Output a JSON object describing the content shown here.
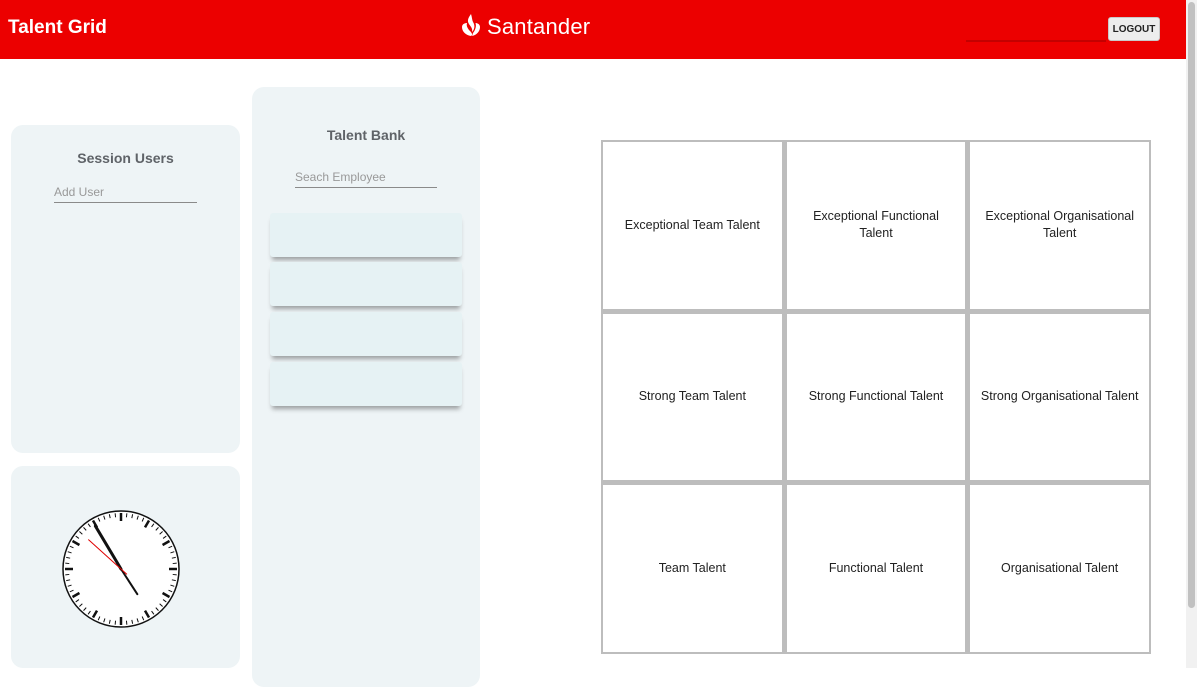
{
  "header": {
    "app_title": "Talent Grid",
    "brand_name": "Santander",
    "logout_label": "LOGOUT",
    "brand_color": "#ec0000"
  },
  "session_users": {
    "title": "Session Users",
    "add_user_placeholder": "Add User"
  },
  "talent_bank": {
    "title": "Talent Bank",
    "search_placeholder": "Seach Employee",
    "cards": [
      "",
      "",
      "",
      ""
    ]
  },
  "clock": {
    "hour": 4,
    "minute": 54,
    "second": 52
  },
  "grid": {
    "cells": [
      "Exceptional Team Talent",
      "Exceptional Functional Talent",
      "Exceptional Organisational Talent",
      "Strong Team Talent",
      "Strong Functional Talent",
      "Strong Organisational Talent",
      "Team Talent",
      "Functional Talent",
      "Organisational Talent"
    ]
  }
}
